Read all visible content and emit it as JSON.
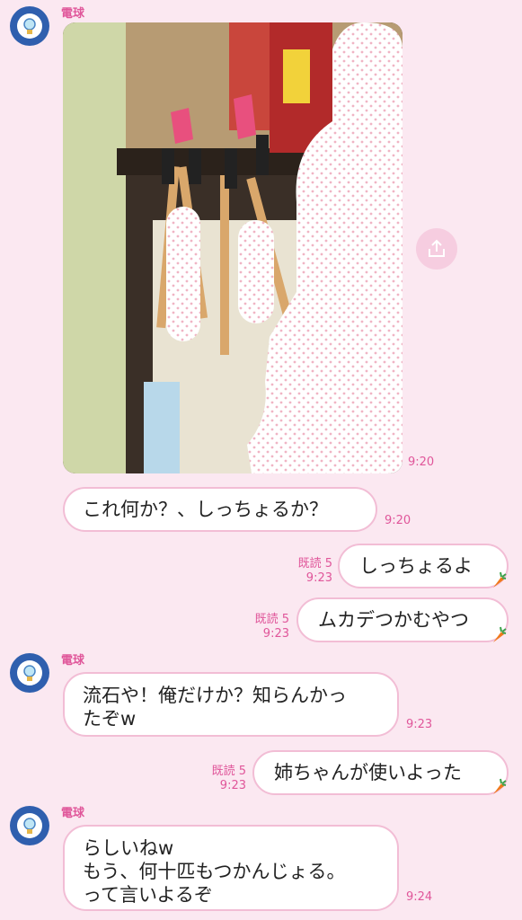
{
  "chat": {
    "sender_name": "電球",
    "messages": [
      {
        "side": "in",
        "type": "image",
        "time": "9:20"
      },
      {
        "side": "in",
        "type": "text",
        "text": "これ何か？、しっちょるか？",
        "time": "9:20"
      },
      {
        "side": "out",
        "type": "text",
        "text": "しっちょるよ",
        "read": "既読 5",
        "time": "9:23"
      },
      {
        "side": "out",
        "type": "text",
        "text": "ムカデつかむやつ",
        "read": "既読 5",
        "time": "9:23"
      },
      {
        "side": "in",
        "type": "text",
        "lines": [
          "流石や！俺だけか？知らんかっ",
          "たぞw"
        ],
        "time": "9:23"
      },
      {
        "side": "out",
        "type": "text",
        "text": "姉ちゃんが使いよった",
        "read": "既読 5",
        "time": "9:23"
      },
      {
        "side": "in",
        "type": "text",
        "lines": [
          "らしいねw",
          "もう、何十匹もつかんじょる。",
          "って言いよるぞ"
        ],
        "time": "9:24"
      }
    ]
  },
  "icons": {
    "avatar": "light-bulb-icon",
    "share": "share-icon",
    "reaction": "carrot-icon"
  },
  "colors": {
    "background": "#fbe8f1",
    "accent": "#e0569a",
    "bubble_border": "#f2bdd5",
    "avatar_bg": "#2f5fae"
  }
}
